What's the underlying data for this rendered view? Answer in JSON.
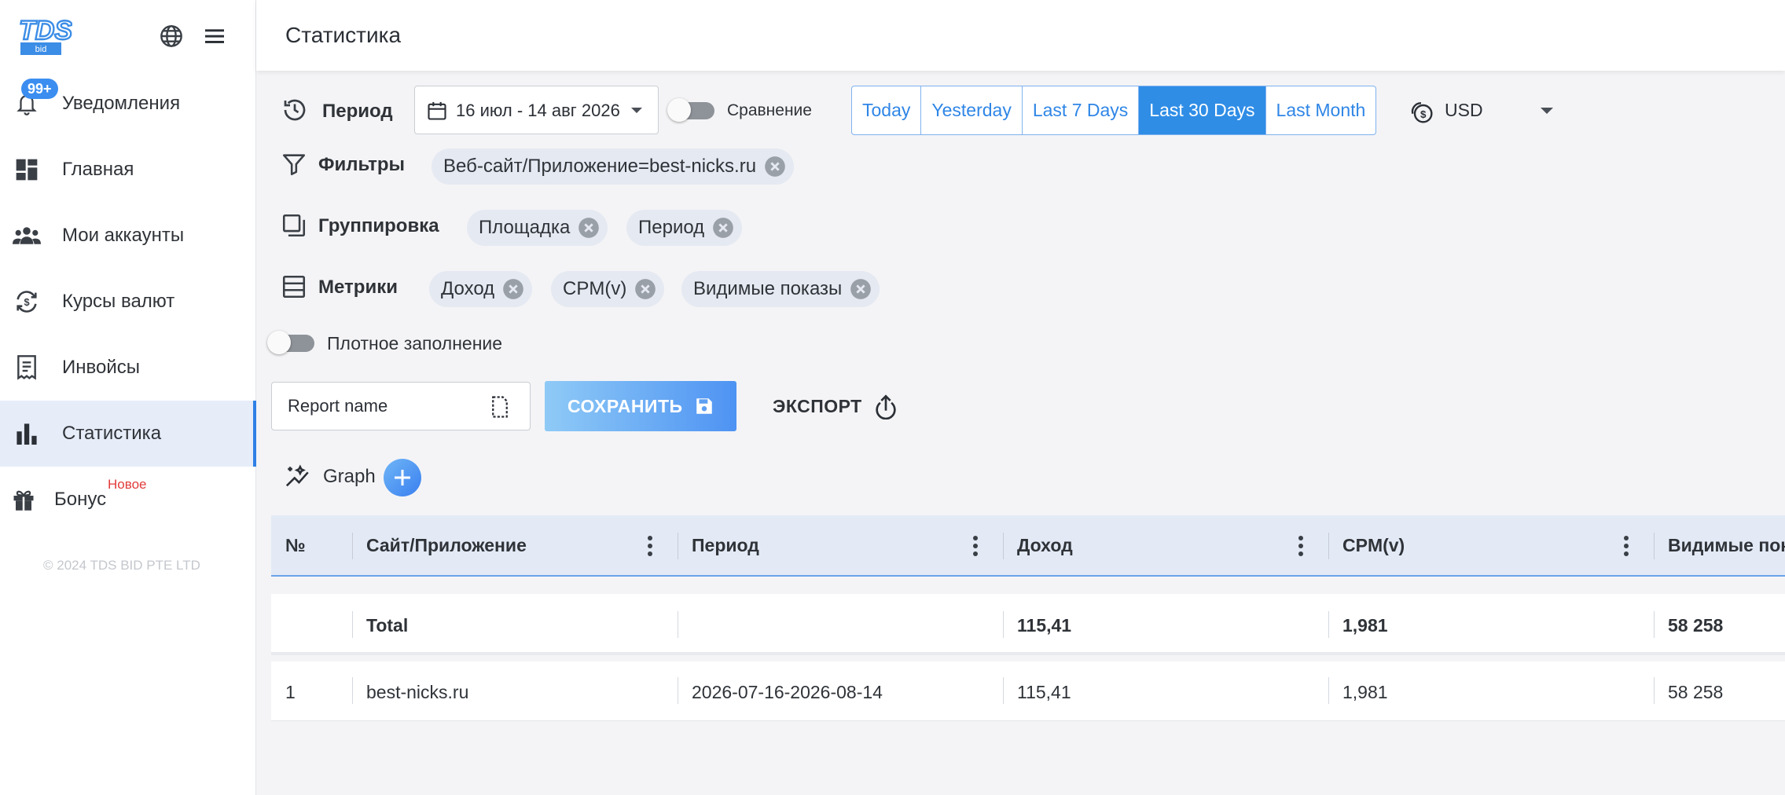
{
  "brand": {
    "logo_text": "TDS",
    "logo_sub": "bid"
  },
  "sidebar": {
    "notifications_badge": "99+",
    "items": [
      {
        "label": "Уведомления",
        "icon": "bell-icon"
      },
      {
        "label": "Главная",
        "icon": "dashboard-icon"
      },
      {
        "label": "Мои аккаунты",
        "icon": "users-icon"
      },
      {
        "label": "Курсы валют",
        "icon": "currency-exchange-icon"
      },
      {
        "label": "Инвойсы",
        "icon": "receipt-icon"
      },
      {
        "label": "Статистика",
        "icon": "bar-chart-icon",
        "active": true
      },
      {
        "label": "Бонус",
        "icon": "gift-icon"
      }
    ],
    "new_badge": "Новое",
    "copyright": "© 2024 TDS BID PTE LTD"
  },
  "header": {
    "title": "Статистика"
  },
  "period": {
    "label": "Период",
    "date_range": "16 июл - 14 авг 2026",
    "compare_label": "Сравнение",
    "ranges": [
      "Today",
      "Yesterday",
      "Last 7 Days",
      "Last 30 Days",
      "Last Month"
    ],
    "active_range": "Last 30 Days",
    "currency": "USD"
  },
  "filters": {
    "label": "Фильтры",
    "chips": [
      "Веб-сайт/Приложение=best-nicks.ru"
    ]
  },
  "grouping": {
    "label": "Группировка",
    "chips": [
      "Площадка",
      "Период"
    ]
  },
  "metrics": {
    "label": "Метрики",
    "chips": [
      "Доход",
      "CPM(v)",
      "Видимые показы"
    ]
  },
  "dense_label": "Плотное заполнение",
  "report": {
    "placeholder": "Report name",
    "save_label": "СОХРАНИТЬ",
    "export_label": "ЭКСПОРТ"
  },
  "graph": {
    "label": "Graph"
  },
  "table": {
    "columns": [
      "№",
      "Сайт/Приложение",
      "Период",
      "Доход",
      "CPM(v)",
      "Видимые пок"
    ],
    "total": {
      "num": "",
      "site": "Total",
      "period": "",
      "income": "115,41",
      "cpm": "1,981",
      "views": "58 258"
    },
    "rows": [
      {
        "num": "1",
        "site": "best-nicks.ru",
        "period": "2026-07-16-2026-08-14",
        "income": "115,41",
        "cpm": "1,981",
        "views": "58 258"
      }
    ]
  },
  "colors": {
    "accent": "#2f8de6",
    "active_bg": "#e6ecf8",
    "chip_bg": "#e5e9f2",
    "new_badge": "#e23b3b"
  }
}
